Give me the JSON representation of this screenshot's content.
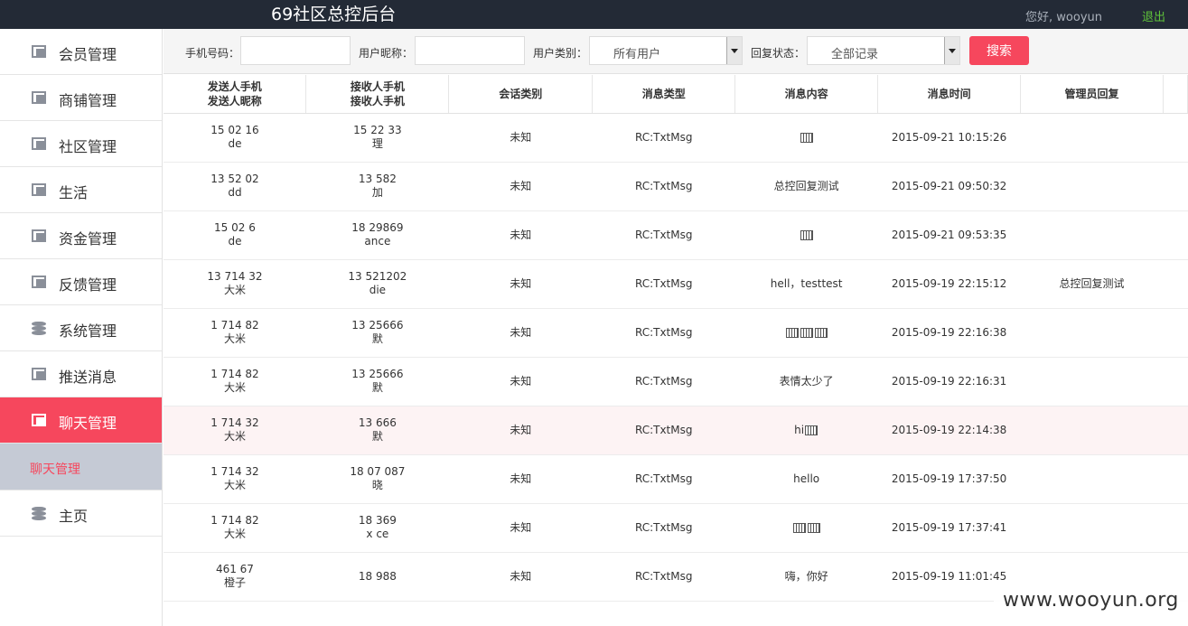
{
  "header": {
    "title": "69社区总控后台",
    "greeting": "您好, wooyun",
    "logout": "退出"
  },
  "sidebar": {
    "items": [
      {
        "label": "会员管理",
        "icon": "window-icon"
      },
      {
        "label": "商铺管理",
        "icon": "window-icon"
      },
      {
        "label": "社区管理",
        "icon": "window-icon"
      },
      {
        "label": "生活",
        "icon": "window-icon"
      },
      {
        "label": "资金管理",
        "icon": "window-icon"
      },
      {
        "label": "反馈管理",
        "icon": "window-icon"
      },
      {
        "label": "系统管理",
        "icon": "database-icon"
      },
      {
        "label": "推送消息",
        "icon": "window-icon"
      },
      {
        "label": "聊天管理",
        "icon": "window-icon",
        "active": true
      },
      {
        "label": "主页",
        "icon": "database-icon"
      }
    ],
    "sub_item": "聊天管理"
  },
  "filter": {
    "phone_label": "手机号码：",
    "phone_value": "",
    "nick_label": "用户昵称：",
    "nick_value": "",
    "type_label": "用户类别：",
    "type_value": "所有用户",
    "reply_label": "回复状态：",
    "reply_value": "全部记录",
    "search_button": "搜索"
  },
  "table": {
    "headers": {
      "sender_1": "发送人手机",
      "sender_2": "发送人昵称",
      "receiver_1": "接收人手机",
      "receiver_2": "接收人手机",
      "session": "会话类别",
      "msgtype": "消息类型",
      "content": "消息内容",
      "time": "消息时间",
      "reply": "管理员回复"
    },
    "rows": [
      {
        "s_phone": "15     02  16",
        "s_nick": "  de",
        "r_phone": "15     22  33",
        "r_nick": "  理",
        "session": "未知",
        "msgtype": "RC:TxtMsg",
        "content": "",
        "glyphs": 1,
        "time": "2015-09-21 10:15:26",
        "reply": ""
      },
      {
        "s_phone": "13     52  02",
        "s_nick": "  dd",
        "r_phone": "13        582",
        "r_nick": "  加",
        "session": "未知",
        "msgtype": "RC:TxtMsg",
        "content": "总控回复测试",
        "glyphs": 0,
        "time": "2015-09-21 09:50:32",
        "reply": ""
      },
      {
        "s_phone": "15     02  6",
        "s_nick": "  de",
        "r_phone": "18    29869",
        "r_nick": "   ance",
        "session": "未知",
        "msgtype": "RC:TxtMsg",
        "content": "",
        "glyphs": 1,
        "time": "2015-09-21 09:53:35",
        "reply": ""
      },
      {
        "s_phone": "13    714   32",
        "s_nick": "大米",
        "r_phone": "13    521202",
        "r_nick": "  die",
        "session": "未知",
        "msgtype": "RC:TxtMsg",
        "content": "hell，testtest",
        "glyphs": 0,
        "time": "2015-09-19 22:15:12",
        "reply": "总控回复测试"
      },
      {
        "s_phone": "1   714   82",
        "s_nick": "大米",
        "r_phone": "13    25666",
        "r_nick": "  默",
        "session": "未知",
        "msgtype": "RC:TxtMsg",
        "content": "",
        "glyphs": 3,
        "time": "2015-09-19 22:16:38",
        "reply": ""
      },
      {
        "s_phone": "1   714   82",
        "s_nick": "大米",
        "r_phone": "13    25666",
        "r_nick": "  默",
        "session": "未知",
        "msgtype": "RC:TxtMsg",
        "content": "表情太少了",
        "glyphs": 0,
        "time": "2015-09-19 22:16:31",
        "reply": ""
      },
      {
        "s_phone": "1   714   32",
        "s_nick": "大米",
        "r_phone": "13      666",
        "r_nick": "  默",
        "session": "未知",
        "msgtype": "RC:TxtMsg",
        "content": "hi",
        "glyphs": 1,
        "time": "2015-09-19 22:14:38",
        "reply": "",
        "highlight": true
      },
      {
        "s_phone": "1   714   32",
        "s_nick": "大米",
        "r_phone": "18   07   087",
        "r_nick": "  晓",
        "session": "未知",
        "msgtype": "RC:TxtMsg",
        "content": "hello",
        "glyphs": 0,
        "time": "2015-09-19 17:37:50",
        "reply": ""
      },
      {
        "s_phone": "1   714   82",
        "s_nick": "大米",
        "r_phone": "18     369",
        "r_nick": "x    ce",
        "session": "未知",
        "msgtype": "RC:TxtMsg",
        "content": "",
        "glyphs": 2,
        "time": "2015-09-19 17:37:41",
        "reply": ""
      },
      {
        "s_phone": "  461   67",
        "s_nick": "橙子",
        "r_phone": "18      988",
        "r_nick": "  ",
        "session": "未知",
        "msgtype": "RC:TxtMsg",
        "content": "嗨，你好",
        "glyphs": 0,
        "time": "2015-09-19 11:01:45",
        "reply": ""
      }
    ]
  },
  "watermark": "www.wooyun.org",
  "colors": {
    "accent": "#f6475d",
    "topbar": "#232a36",
    "logout": "#5fc33a",
    "submenu": "#c5cad5"
  }
}
